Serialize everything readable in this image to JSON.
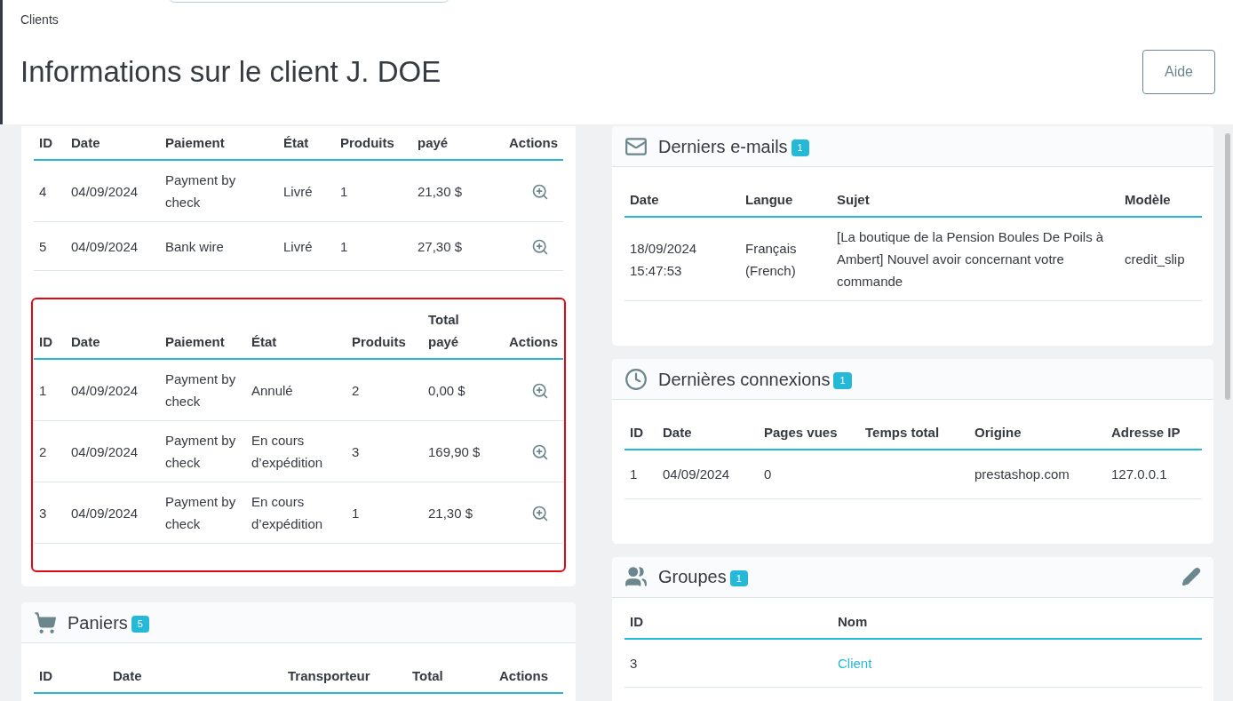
{
  "header": {
    "breadcrumb": "Clients",
    "title": "Informations sur le client J. DOE",
    "help_button": "Aide"
  },
  "orders_tables": [
    {
      "highlighted": false,
      "columns": [
        "ID",
        "Date",
        "Paiement",
        "État",
        "Produits",
        "payé",
        "Actions"
      ],
      "rows": [
        {
          "cells": [
            "4",
            "04/09/2024",
            "Payment by check",
            "Livré",
            "1",
            "21,30 $"
          ]
        },
        {
          "cells": [
            "5",
            "04/09/2024",
            "Bank wire",
            "Livré",
            "1",
            "27,30 $"
          ]
        }
      ]
    },
    {
      "highlighted": true,
      "columns": [
        "ID",
        "Date",
        "Paiement",
        "État",
        "Produits",
        "Total payé",
        "Actions"
      ],
      "rows": [
        {
          "cells": [
            "1",
            "04/09/2024",
            "Payment by check",
            "Annulé",
            "2",
            "0,00 $"
          ]
        },
        {
          "cells": [
            "2",
            "04/09/2024",
            "Payment by check",
            "En cours d’expédition",
            "3",
            "169,90 $"
          ]
        },
        {
          "cells": [
            "3",
            "04/09/2024",
            "Payment by check",
            "En cours d’expédition",
            "1",
            "21,30 $"
          ]
        }
      ]
    }
  ],
  "carts": {
    "title": "Paniers",
    "badge": "5",
    "columns": [
      "ID",
      "Date",
      "Transporteur",
      "Total",
      "Actions"
    ]
  },
  "emails": {
    "title": "Derniers e-mails",
    "badge": "1",
    "columns": [
      "Date",
      "Langue",
      "Sujet",
      "Modèle"
    ],
    "rows": [
      {
        "cells": [
          "18/09/2024 15:47:53",
          "Français (French)",
          "[La boutique de la Pension Boules De Poils à Ambert] Nouvel avoir concernant votre commande",
          "credit_slip"
        ]
      }
    ]
  },
  "connections": {
    "title": "Dernières connexions",
    "badge": "1",
    "columns": [
      "ID",
      "Date",
      "Pages vues",
      "Temps total",
      "Origine",
      "Adresse IP"
    ],
    "rows": [
      {
        "cells": [
          "1",
          "04/09/2024",
          "0",
          null,
          "prestashop.com",
          "127.0.0.1"
        ]
      }
    ]
  },
  "groups": {
    "title": "Groupes",
    "badge": "1",
    "columns": [
      "ID",
      "Nom"
    ],
    "rows": [
      {
        "cells": [
          "3",
          "Client"
        ],
        "kind": "link"
      }
    ]
  }
}
